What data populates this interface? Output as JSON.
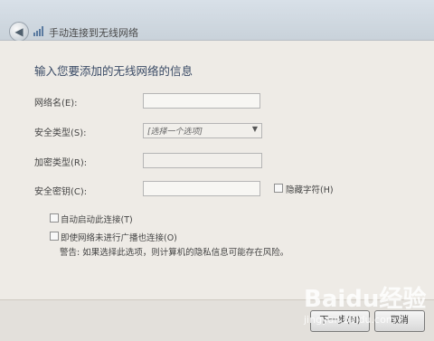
{
  "window": {
    "title": "手动连接到无线网络",
    "back_icon": "back-arrow-icon",
    "wifi_icon": "wifi-icon"
  },
  "form": {
    "heading": "输入您要添加的无线网络的信息",
    "network_name_label": "网络名(E):",
    "network_name_value": "",
    "security_type_label": "安全类型(S):",
    "security_type_value": "[选择一个选项]",
    "encryption_type_label": "加密类型(R):",
    "encryption_type_value": "",
    "security_key_label": "安全密钥(C):",
    "security_key_value": "",
    "hide_chars_label": "隐藏字符(H)",
    "auto_connect_label": "自动启动此连接(T)",
    "connect_even_if_not_broadcasting_label": "即使网络未进行广播也连接(O)",
    "warning_text": "警告: 如果选择此选项，则计算机的隐私信息可能存在风险。"
  },
  "buttons": {
    "next_label": "下一步(N)",
    "cancel_label": "取消"
  },
  "watermark": {
    "text": "Baidu经验",
    "sub": "jingyan.baidu.com"
  }
}
